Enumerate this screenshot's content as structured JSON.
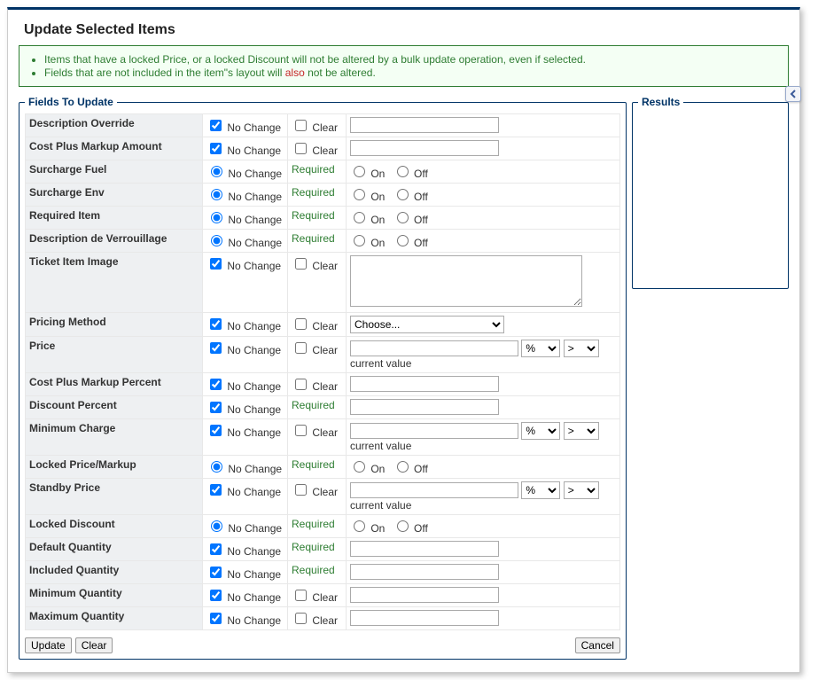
{
  "title": "Update Selected Items",
  "notice": {
    "line1": "Items that have a locked Price, or a locked Discount will not be altered by a bulk update operation, even if selected.",
    "line2a": "Fields that are not included in the item\"s layout will ",
    "line2_also": "also",
    "line2b": " not be altered."
  },
  "legend": {
    "fields": "Fields To Update",
    "results": "Results"
  },
  "labels": {
    "no_change": "No Change",
    "clear": "Clear",
    "required": "Required",
    "on": "On",
    "off": "Off",
    "current_value": "current value",
    "choose": "Choose...",
    "pct": "%",
    "gt": ">"
  },
  "buttons": {
    "update": "Update",
    "clear": "Clear",
    "cancel": "Cancel"
  },
  "rows": {
    "description_override": "Description Override",
    "cost_plus_markup_amount": "Cost Plus Markup Amount",
    "surcharge_fuel": "Surcharge Fuel",
    "surcharge_env": "Surcharge Env",
    "required_item": "Required Item",
    "description_de_verrouillage": "Description de Verrouillage",
    "ticket_item_image": "Ticket Item Image",
    "pricing_method": "Pricing Method",
    "price": "Price",
    "cost_plus_markup_percent": "Cost Plus Markup Percent",
    "discount_percent": "Discount Percent",
    "minimum_charge": "Minimum Charge",
    "locked_price_markup": "Locked Price/Markup",
    "standby_price": "Standby Price",
    "locked_discount": "Locked Discount",
    "default_quantity": "Default Quantity",
    "included_quantity": "Included Quantity",
    "minimum_quantity": "Minimum Quantity",
    "maximum_quantity": "Maximum Quantity"
  }
}
